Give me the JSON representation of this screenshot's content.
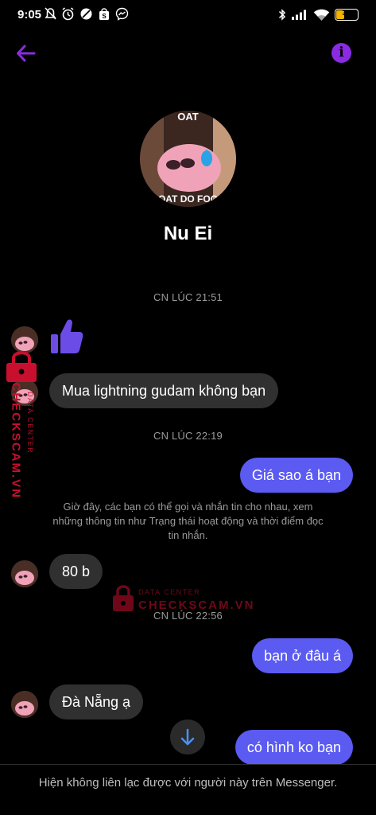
{
  "status_bar": {
    "time": "9:05",
    "battery_level": "36",
    "battery_fraction": 0.36
  },
  "header": {
    "back_icon": "arrow-left-icon",
    "info_icon": "info-icon",
    "info_glyph": "i"
  },
  "profile": {
    "name": "Nu Ei",
    "avatar_text_top": "OAT",
    "avatar_text_bottom": "OAT DO FOO"
  },
  "conversation": {
    "timestamps": [
      "CN LÚC 21:51",
      "CN LÚC 22:19",
      "CN LÚC 22:56"
    ],
    "messages": [
      {
        "direction": "in",
        "type": "like",
        "icon": "thumbs-up-icon"
      },
      {
        "direction": "in",
        "text": "Mua lightning gudam không bạn"
      },
      {
        "direction": "out",
        "text": "Giá sao á bạn"
      },
      {
        "direction": "in",
        "text": "80 b"
      },
      {
        "direction": "out",
        "text": "bạn ở đâu á"
      },
      {
        "direction": "in",
        "text": "Đà Nẵng ạ"
      },
      {
        "direction": "out",
        "text": "có hình ko bạn"
      }
    ],
    "system_note": "Giờ đây, các bạn có thể gọi và nhắn tin cho nhau, xem những thông tin như Trạng thái hoạt động và thời điểm đọc tin nhắn."
  },
  "footer": {
    "notice": "Hiện không liên lạc được với người này trên Messenger."
  },
  "watermark": {
    "brand": "CHECKSCAM.VN",
    "tagline": "DATA CENTER"
  },
  "colors": {
    "background": "#000000",
    "accent": "#8a2be2",
    "outgoing_bubble": "#5b5bf2",
    "incoming_bubble": "#303030",
    "watermark": "#c8102e"
  }
}
